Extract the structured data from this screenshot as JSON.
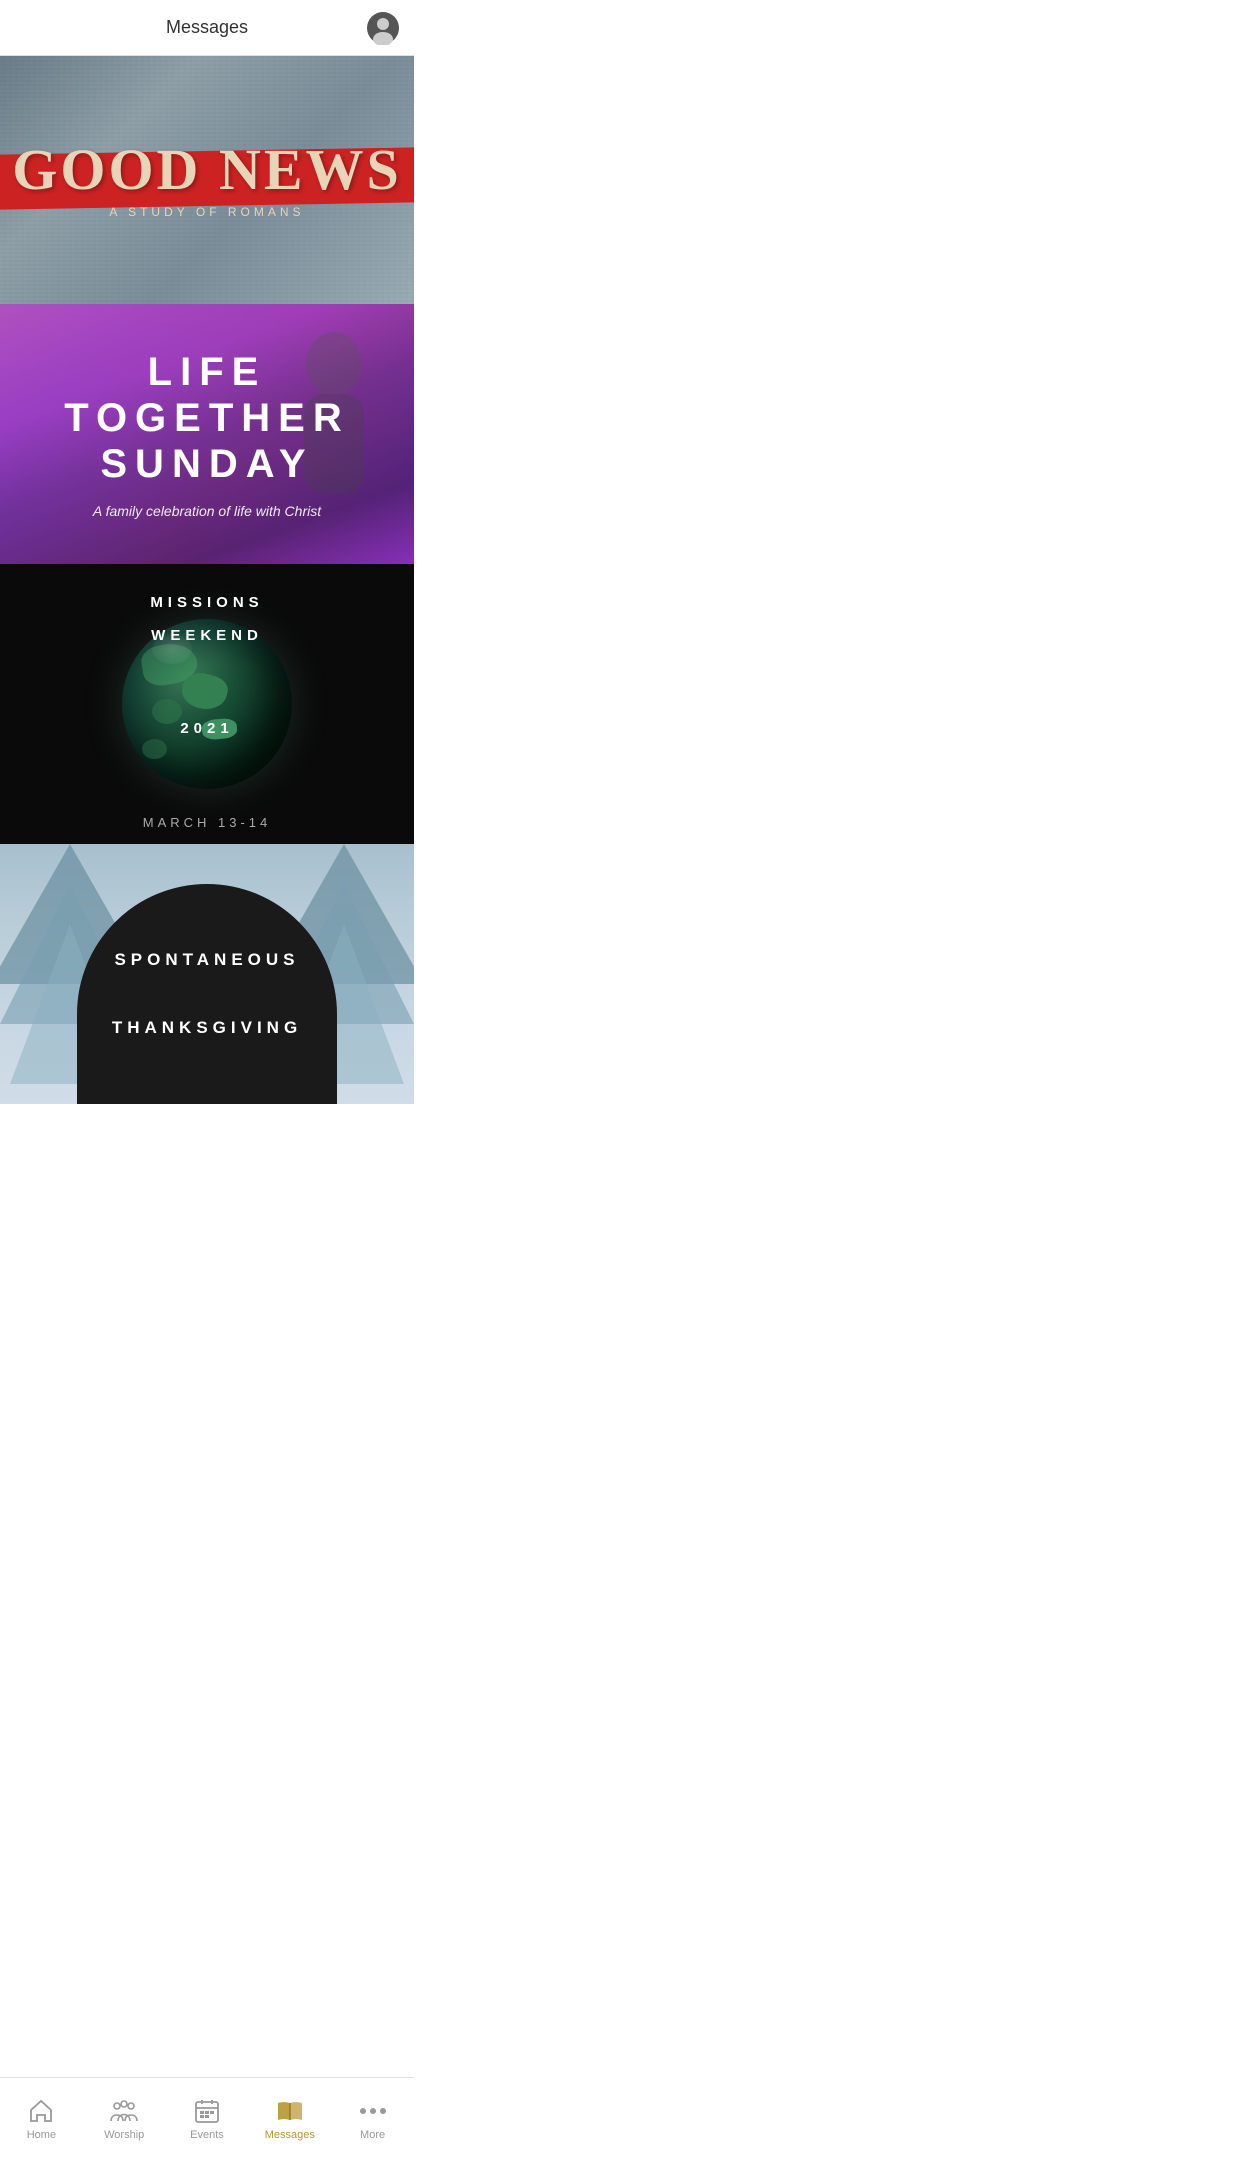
{
  "header": {
    "title": "Messages",
    "avatar_label": "User Profile"
  },
  "cards": [
    {
      "id": "good-news",
      "title": "GOOD NEWS",
      "subtitle": "A STUDY OF ROMANS",
      "bg_color": "#8a9ba8"
    },
    {
      "id": "life-together",
      "title_line1": "LIFE",
      "title_line2": "TOGETHER",
      "title_line3": "SUNDAY",
      "subtitle": "A family celebration of life with Christ"
    },
    {
      "id": "missions-weekend",
      "title_line1": "MISSIONS",
      "title_line2": "WEEKEND",
      "title_line3": "2021",
      "date": "MARCH 13-14"
    },
    {
      "id": "spontaneous-thanksgiving",
      "title_line1": "SPONTANEOUS",
      "title_line2": "",
      "title_line3": "THANKSGIVING"
    }
  ],
  "bottom_nav": {
    "items": [
      {
        "id": "home",
        "label": "Home",
        "active": false
      },
      {
        "id": "worship",
        "label": "Worship",
        "active": false
      },
      {
        "id": "events",
        "label": "Events",
        "active": false
      },
      {
        "id": "messages",
        "label": "Messages",
        "active": true
      },
      {
        "id": "more",
        "label": "More",
        "active": false
      }
    ]
  }
}
